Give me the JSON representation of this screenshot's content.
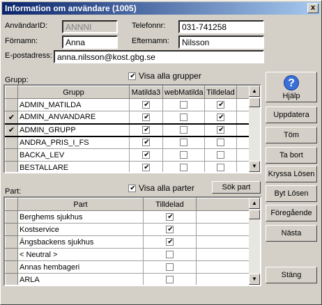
{
  "window": {
    "title": "Information om användare (1005)",
    "close": "x"
  },
  "form": {
    "anvandarid_label": "AnvändarID:",
    "anvandarid_value": "ANNNI",
    "fornamn_label": "Förnamn:",
    "fornamn_value": "Anna",
    "epost_label": "E-postadress:",
    "epost_value": "anna.nilsson@kost.gbg.se",
    "telefon_label": "Telefonnr:",
    "telefon_value": "031-741258",
    "efternamn_label": "Efternamn:",
    "efternamn_value": "Nilsson"
  },
  "grupp": {
    "label": "Grupp:",
    "show_all_label": "Visa alla grupper",
    "show_all_checked": true,
    "headers": [
      "Grupp",
      "Matilda3",
      "webMatilda",
      "Tilldelad"
    ],
    "rows": [
      {
        "marker": "",
        "name": "ADMIN_MATILDA",
        "matilda3": true,
        "webmatilda": false,
        "tilldelad": true
      },
      {
        "marker": "✔",
        "name": "ADMIN_ANVANDARE",
        "matilda3": true,
        "webmatilda": false,
        "tilldelad": true
      },
      {
        "marker": "✔",
        "name": "ADMIN_GRUPP",
        "matilda3": true,
        "webmatilda": false,
        "tilldelad": true
      },
      {
        "marker": "",
        "name": "ANDRA_PRIS_I_FS",
        "matilda3": true,
        "webmatilda": false,
        "tilldelad": false
      },
      {
        "marker": "",
        "name": "BACKA_LEV",
        "matilda3": true,
        "webmatilda": false,
        "tilldelad": false
      },
      {
        "marker": "",
        "name": "BESTALLARE",
        "matilda3": true,
        "webmatilda": false,
        "tilldelad": false
      }
    ]
  },
  "part": {
    "label": "Part:",
    "show_all_label": "Visa alla parter",
    "show_all_checked": true,
    "search_button": "Sök part",
    "headers": [
      "Part",
      "Tilldelad"
    ],
    "rows": [
      {
        "name": "Berghems sjukhus",
        "tilldelad": true
      },
      {
        "name": "Kostservice",
        "tilldelad": true
      },
      {
        "name": "Ängsbackens sjukhus",
        "tilldelad": true
      },
      {
        "name": "< Neutral >",
        "tilldelad": false
      },
      {
        "name": "Annas hembageri",
        "tilldelad": false
      },
      {
        "name": "ARLA",
        "tilldelad": false
      }
    ]
  },
  "buttons": {
    "help": "Hjälp",
    "uppdatera": "Uppdatera",
    "tom": "Töm",
    "ta_bort": "Ta bort",
    "kryssa_losen": "Kryssa Lösen",
    "byt_losen": "Byt Lösen",
    "foregaende": "Föregående",
    "nasta": "Nästa",
    "stang": "Stäng"
  }
}
